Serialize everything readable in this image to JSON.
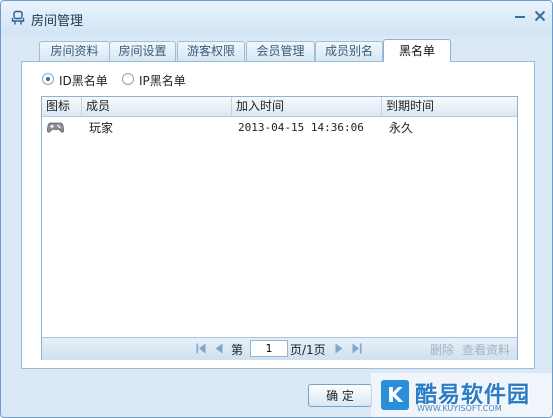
{
  "window": {
    "title": "房间管理",
    "title_icon": "chair-icon"
  },
  "tabs": [
    {
      "label": "房间资料",
      "active": false
    },
    {
      "label": "房间设置",
      "active": false
    },
    {
      "label": "游客权限",
      "active": false
    },
    {
      "label": "会员管理",
      "active": false
    },
    {
      "label": "成员别名",
      "active": false
    },
    {
      "label": "黑名单",
      "active": true
    }
  ],
  "blacklist": {
    "radios": [
      {
        "label": "ID黑名单",
        "selected": true
      },
      {
        "label": "IP黑名单",
        "selected": false
      }
    ],
    "columns": [
      "图标",
      "成员",
      "加入时间",
      "到期时间"
    ],
    "rows": [
      {
        "icon": "gamepad-icon",
        "member": "玩家",
        "joined": "2013-04-15 14:36:06",
        "expires": "永久"
      }
    ]
  },
  "pager": {
    "page_prefix": "第",
    "page_value": "1",
    "page_suffix": "页/1页",
    "delete_label": "删除",
    "view_profile_label": "查看资料"
  },
  "footer": {
    "ok_label": "确 定"
  },
  "watermark": {
    "logo_letter": "K",
    "name": "酷易软件园",
    "url": "WWW.KUYISOFT.COM"
  },
  "colors": {
    "accent": "#2c6fb3",
    "window_bg": "#dbe9f6",
    "disabled_link": "#a5b3c1"
  }
}
